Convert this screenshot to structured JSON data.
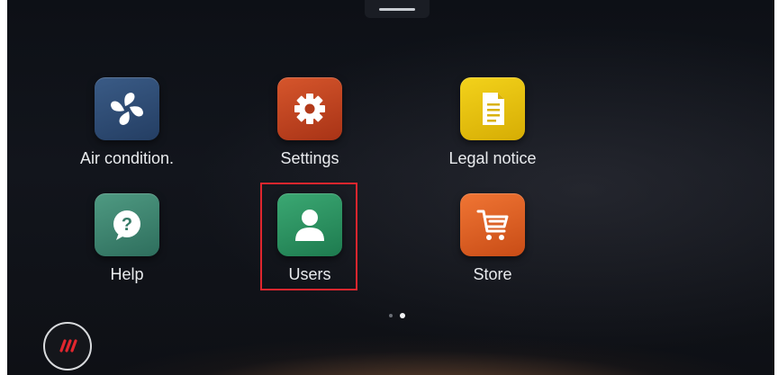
{
  "apps": [
    {
      "id": "air",
      "label": "Air condition.",
      "icon": "fan-icon"
    },
    {
      "id": "settings",
      "label": "Settings",
      "icon": "gear-icon"
    },
    {
      "id": "legal",
      "label": "Legal notice",
      "icon": "document-icon"
    },
    {
      "id": "help",
      "label": "Help",
      "icon": "question-bubble-icon"
    },
    {
      "id": "users",
      "label": "Users",
      "icon": "user-icon",
      "highlighted": true
    },
    {
      "id": "store",
      "label": "Store",
      "icon": "shopping-cart-icon"
    }
  ],
  "pager": {
    "pages": 2,
    "current": 2
  },
  "brand": {
    "icon": "brand-logo-icon"
  },
  "colors": {
    "highlight": "#e0262e",
    "air": "#2f4d77",
    "settings": "#c2421f",
    "legal": "#e8c20c",
    "help": "#3f8670",
    "users": "#2a9160",
    "store": "#e0612a"
  }
}
